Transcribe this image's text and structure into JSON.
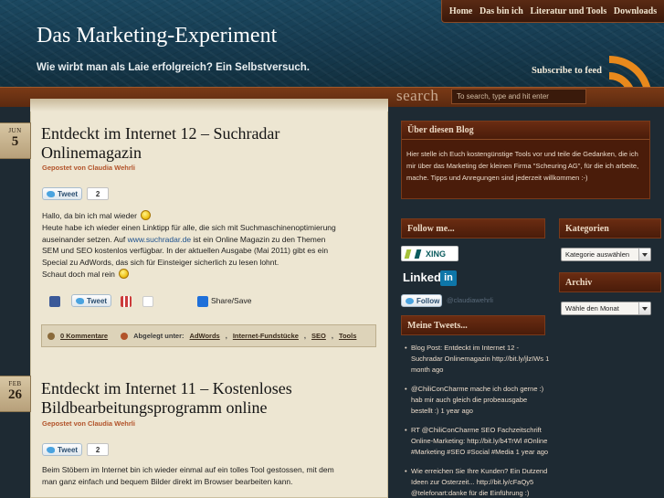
{
  "header": {
    "site_title": "Das Marketing-Experiment",
    "tagline": "Wie wirbt man als Laie erfolgreich? Ein Selbstversuch.",
    "subscribe_label": "Subscribe to feed",
    "nav": [
      "Home",
      "Das bin ich",
      "Literatur und Tools",
      "Downloads"
    ]
  },
  "search": {
    "label": "search",
    "placeholder": "To search, type and hit enter"
  },
  "posts": [
    {
      "month": "JUN",
      "day": "5",
      "title": "Entdeckt im Internet 12 – Suchradar Onlinemagazin",
      "author_line": "Gepostet von Claudia Wehrli",
      "tweet_label": "Tweet",
      "tweet_count": "2",
      "body_line1": "Hallo, da bin ich mal wieder",
      "body_p2_before": "Heute habe ich wieder einen Linktipp für alle, die sich mit Suchmaschinenoptimierung auseinander setzen. Auf",
      "body_link": "www.suchradar.de",
      "body_p2_after": "ist ein Online Magazin zu den Themen SEM und SEO kostenlos verfügbar. In der aktuellen Ausgabe (Mai 2011) gibt es ein Special zu AdWords, das sich für Einsteiger sicherlich zu lesen lohnt.",
      "body_line3": "Schaut doch mal rein",
      "share_label": "Share/Save",
      "comments": "0 Kommentare",
      "filed_under_label": "Abgelegt unter:",
      "tags": [
        "AdWords",
        "Internet-Fundstücke",
        "SEO",
        "Tools"
      ]
    },
    {
      "month": "FEB",
      "day": "26",
      "title": "Entdeckt im Internet 11 – Kostenloses Bildbearbeitungsprogramm online",
      "author_line": "Gepostet von Claudia Wehrli",
      "tweet_label": "Tweet",
      "tweet_count": "2",
      "body": "Beim Stöbern im Internet bin ich wieder einmal auf ein tolles Tool gestossen, mit dem man ganz einfach und bequem Bilder direkt im Browser bearbeiten kann."
    }
  ],
  "sidebar": {
    "about_title": "Über diesen Blog",
    "about_text": "Hier stelle ich Euch kostengünstige Tools vor und teile die Gedanken, die ich mir über das Marketing der kleinen Firma \"Scheuring AG\", für die ich arbeite, mache. Tipps und Anregungen sind jederzeit willkommen :-)",
    "follow_title": "Follow me...",
    "xing_label": "XING",
    "linkedin_label": "Linked",
    "linkedin_in": "in",
    "follow_btn": "Follow",
    "follow_handle": "@claudiawehrli",
    "categories_title": "Kategorien",
    "categories_select": "Kategorie auswählen",
    "archive_title": "Archiv",
    "archive_select": "Wähle den Monat",
    "tweets_title": "Meine Tweets...",
    "tweets": [
      "Blog Post: Entdeckt im Internet 12 - Suchradar Onlinemagazin http://bit.ly/jlzIWs 1 month ago",
      "@ChiliConCharme mache ich doch gerne :) hab mir auch gleich die probeausgabe bestellt :) 1 year ago",
      "RT @ChiliConCharme SEO Fachzeitschrift Online-Marketing: http://bit.ly/b4TrWl #Online #Marketing #SEO #Social #Media 1 year ago",
      "Wie erreichen Sie Ihre Kunden? Ein Dutzend Ideen zur Osterzeit... http://bit.ly/cFaQy5 @telefonart:danke für die Einführung :)"
    ]
  },
  "colors": {
    "header_bg": "#163a4f",
    "accent_brown": "#4a1c0a",
    "meta_orange": "#b2532a",
    "link_blue": "#1b4f8c",
    "paper": "#ede6d2"
  }
}
